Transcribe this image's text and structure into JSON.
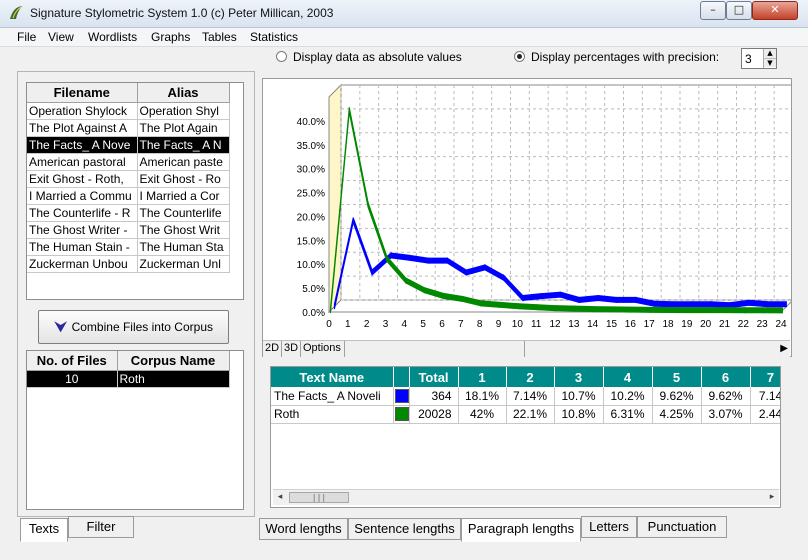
{
  "window": {
    "title": "Signature Stylometric System 1.0  (c) Peter Millican, 2003",
    "min_symbol": "–",
    "max_symbol": "□",
    "close_symbol": "✕"
  },
  "menu": [
    "File",
    "View",
    "Wordlists",
    "Graphs",
    "Tables",
    "Statistics"
  ],
  "options": {
    "absolute_label": "Display data as absolute values",
    "percent_label": "Display percentages with precision:",
    "selected": "percent",
    "precision": "3",
    "spin_up": "▲",
    "spin_down": "▼"
  },
  "files": {
    "headers": [
      "Filename",
      "Alias"
    ],
    "rows": [
      [
        "Operation Shylock",
        "Operation Shyl"
      ],
      [
        "The Plot Against A",
        "The Plot Again"
      ],
      [
        "The Facts_ A Nove",
        "The Facts_ A N"
      ],
      [
        "American pastoral",
        "American paste"
      ],
      [
        "Exit Ghost - Roth,",
        "Exit Ghost - Ro"
      ],
      [
        "I Married a Commu",
        "I Married a Cor"
      ],
      [
        "The Counterlife - R",
        "The Counterlife"
      ],
      [
        "The Ghost Writer -",
        "The Ghost Writ"
      ],
      [
        "The Human Stain -",
        "The Human Sta"
      ],
      [
        "Zuckerman Unbou",
        "Zuckerman Unl"
      ]
    ],
    "selected_index": 2
  },
  "combine_button": "Combine Files into Corpus",
  "combine_arrow": "⮟",
  "corpus": {
    "headers": [
      "No. of Files",
      "Corpus Name"
    ],
    "rows": [
      [
        "10",
        "Roth"
      ]
    ]
  },
  "left_tabs": [
    "Texts",
    "Filter"
  ],
  "chart_toolbar": {
    "btn_2d": "2D",
    "btn_3d": "3D",
    "btn_options": "Options",
    "right_arrow": "▶"
  },
  "bottom_tabs": [
    "Word lengths",
    "Sentence lengths",
    "Paragraph lengths",
    "Letters",
    "Punctuation"
  ],
  "active_bottom_tab": "Paragraph lengths",
  "data_table": {
    "headers": [
      "Text Name",
      "",
      "Total",
      "1",
      "2",
      "3",
      "4",
      "5",
      "6",
      "7"
    ],
    "rows": [
      {
        "name": "The Facts_ A Noveli",
        "color": "#0000ff",
        "total": "364",
        "values": [
          "18.1%",
          "7.14%",
          "10.7%",
          "10.2%",
          "9.62%",
          "9.62%",
          "7.14"
        ]
      },
      {
        "name": "Roth",
        "color": "#008800",
        "total": "20028",
        "values": [
          "42%",
          "22.1%",
          "10.8%",
          "6.31%",
          "4.25%",
          "3.07%",
          "2.44"
        ]
      }
    ]
  },
  "scroll": {
    "thumb_grip": "|||",
    "left_arrow": "◂",
    "right_arrow": "▸"
  },
  "chart_data": {
    "type": "line",
    "title": "",
    "xlabel": "",
    "ylabel": "",
    "x": [
      0,
      1,
      2,
      3,
      4,
      5,
      6,
      7,
      8,
      9,
      10,
      11,
      12,
      13,
      14,
      15,
      16,
      17,
      18,
      19,
      20,
      21,
      22,
      23,
      24
    ],
    "ylim": [
      0,
      45
    ],
    "yticks": [
      "0.0%",
      "5.0%",
      "10.0%",
      "15.0%",
      "20.0%",
      "25.0%",
      "30.0%",
      "35.0%",
      "40.0%"
    ],
    "grid": true,
    "style": "3D ribbon",
    "series": [
      {
        "name": "The Facts_ A Noveli",
        "color": "#0000ff",
        "values": [
          0,
          18.1,
          7.14,
          10.7,
          10.2,
          9.62,
          9.62,
          7.14,
          8.2,
          6.0,
          1.8,
          2.2,
          2.5,
          1.4,
          1.8,
          1.4,
          1.4,
          0.6,
          0.5,
          0.5,
          0.5,
          0.3,
          0.8,
          0.5,
          0.5
        ]
      },
      {
        "name": "Roth",
        "color": "#008800",
        "values": [
          0,
          42,
          22.1,
          10.8,
          6.31,
          4.25,
          3.07,
          2.44,
          1.5,
          1.2,
          0.9,
          0.7,
          0.5,
          0.4,
          0.3,
          0.25,
          0.2,
          0.15,
          0.12,
          0.1,
          0.1,
          0.08,
          0.07,
          0.06,
          0.05
        ]
      }
    ]
  }
}
